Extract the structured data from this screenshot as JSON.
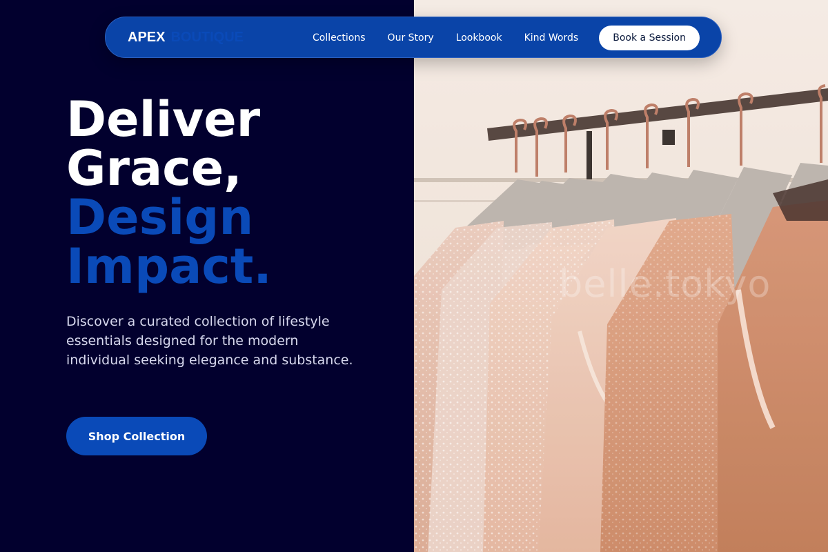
{
  "brand": {
    "name": "APEX",
    "sub": "BOUTIQUE"
  },
  "nav": {
    "links": [
      "Collections",
      "Our Story",
      "Lookbook",
      "Kind Words"
    ],
    "cta_label": "Book a Session"
  },
  "hero": {
    "headline_white_1": "Deliver",
    "headline_white_2": "Grace,",
    "headline_blue_1": "Design",
    "headline_blue_2": "Impact.",
    "description": "Discover a curated collection of lifestyle essentials designed for the modern individual seeking elegance and substance.",
    "button_label": "Shop Collection"
  },
  "photo": {
    "subject": "pink and peach dresses hanging on a clothing rack",
    "watermark": "belle.tokyo"
  },
  "colors": {
    "background": "#02002e",
    "accent": "#0a4ab8",
    "nav": "#0a44a8",
    "text_light": "#d7d8ee"
  }
}
